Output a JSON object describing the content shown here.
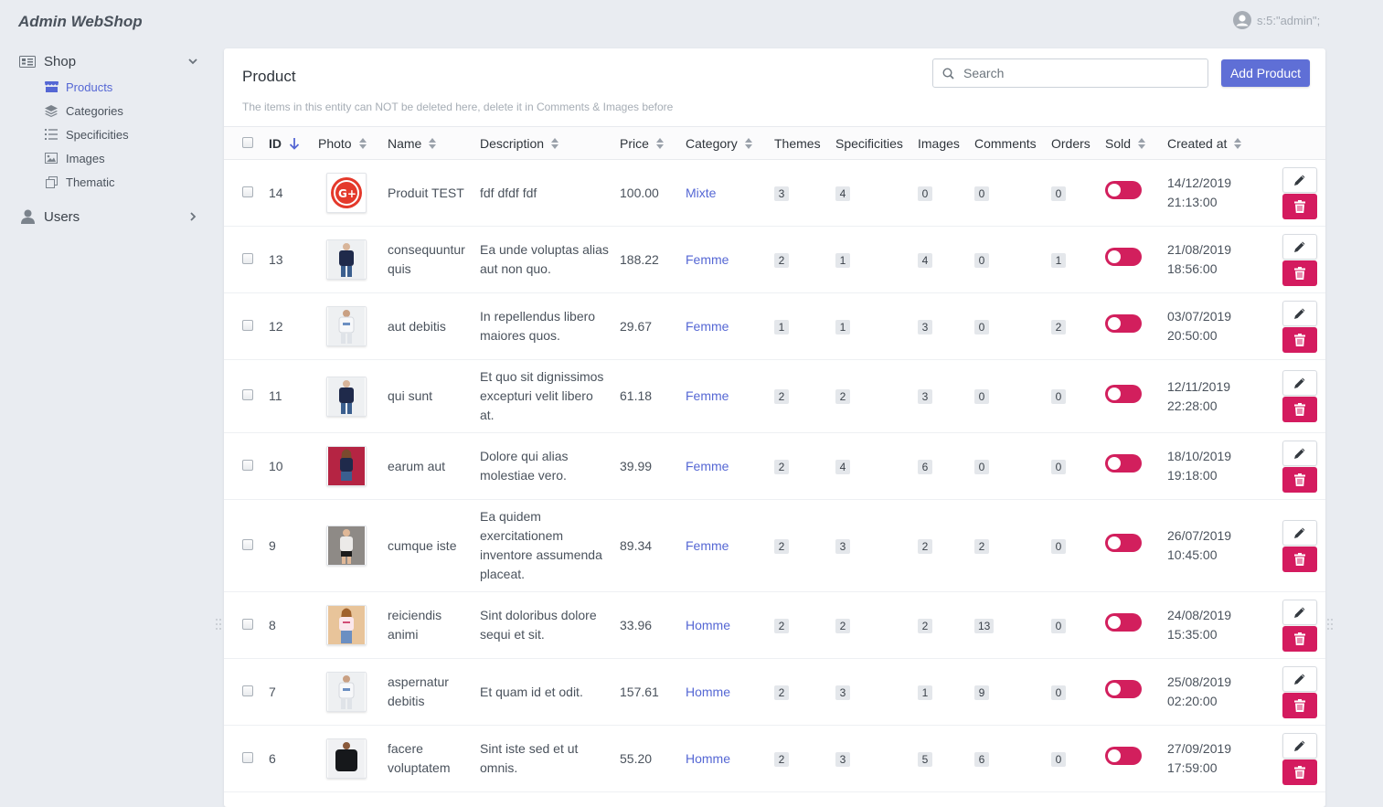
{
  "app": {
    "title": "Admin WebShop",
    "user": "s:5:\"admin\";"
  },
  "sidebar": {
    "shop": {
      "label": "Shop",
      "icon": "shop-icon"
    },
    "shop_items": [
      {
        "label": "Products",
        "icon": "store-icon",
        "active": true
      },
      {
        "label": "Categories",
        "icon": "layers-icon",
        "active": false
      },
      {
        "label": "Specificities",
        "icon": "list-icon",
        "active": false
      },
      {
        "label": "Images",
        "icon": "image-icon",
        "active": false
      },
      {
        "label": "Thematic",
        "icon": "clone-icon",
        "active": false
      }
    ],
    "users": {
      "label": "Users",
      "icon": "user-icon"
    }
  },
  "panel": {
    "title": "Product",
    "search_placeholder": "Search",
    "add_label": "Add Product",
    "help": "The items in this entity can NOT be deleted here, delete it in Comments & Images before"
  },
  "table": {
    "headers": {
      "id": "ID",
      "photo": "Photo",
      "name": "Name",
      "description": "Description",
      "price": "Price",
      "category": "Category",
      "themes": "Themes",
      "specificities": "Specificities",
      "images": "Images",
      "comments": "Comments",
      "orders": "Orders",
      "sold": "Sold",
      "created": "Created at"
    },
    "rows": [
      {
        "id": "14",
        "photo": "gplus",
        "name": "Produit TEST",
        "description": "fdf dfdf fdf",
        "price": "100.00",
        "category": "Mixte",
        "themes": "3",
        "specificities": "4",
        "images": "0",
        "comments": "0",
        "orders": "0",
        "date": "14/12/2019",
        "time": "21:13:00"
      },
      {
        "id": "13",
        "photo": "navy",
        "name": "consequuntur quis",
        "description": "Ea unde voluptas alias aut non quo.",
        "price": "188.22",
        "category": "Femme",
        "themes": "2",
        "specificities": "1",
        "images": "4",
        "comments": "0",
        "orders": "1",
        "date": "21/08/2019",
        "time": "18:56:00"
      },
      {
        "id": "12",
        "photo": "white",
        "name": "aut debitis",
        "description": "In repellendus libero maiores quos.",
        "price": "29.67",
        "category": "Femme",
        "themes": "1",
        "specificities": "1",
        "images": "3",
        "comments": "0",
        "orders": "2",
        "date": "03/07/2019",
        "time": "20:50:00"
      },
      {
        "id": "11",
        "photo": "navy",
        "name": "qui sunt",
        "description": "Et quo sit dignissimos excepturi velit libero at.",
        "price": "61.18",
        "category": "Femme",
        "themes": "2",
        "specificities": "2",
        "images": "3",
        "comments": "0",
        "orders": "0",
        "date": "12/11/2019",
        "time": "22:28:00"
      },
      {
        "id": "10",
        "photo": "red",
        "name": "earum aut",
        "description": "Dolore qui alias molestiae vero.",
        "price": "39.99",
        "category": "Femme",
        "themes": "2",
        "specificities": "4",
        "images": "6",
        "comments": "0",
        "orders": "0",
        "date": "18/10/2019",
        "time": "19:18:00"
      },
      {
        "id": "9",
        "photo": "grey",
        "name": "cumque iste",
        "description": "Ea quidem exercitationem inventore assumenda placeat.",
        "price": "89.34",
        "category": "Femme",
        "themes": "2",
        "specificities": "3",
        "images": "2",
        "comments": "2",
        "orders": "0",
        "date": "26/07/2019",
        "time": "10:45:00"
      },
      {
        "id": "8",
        "photo": "pink",
        "name": "reiciendis animi",
        "description": "Sint doloribus dolore sequi et sit.",
        "price": "33.96",
        "category": "Homme",
        "themes": "2",
        "specificities": "2",
        "images": "2",
        "comments": "13",
        "orders": "0",
        "date": "24/08/2019",
        "time": "15:35:00"
      },
      {
        "id": "7",
        "photo": "white",
        "name": "aspernatur debitis",
        "description": "Et quam id et odit.",
        "price": "157.61",
        "category": "Homme",
        "themes": "2",
        "specificities": "3",
        "images": "1",
        "comments": "9",
        "orders": "0",
        "date": "25/08/2019",
        "time": "02:20:00"
      },
      {
        "id": "6",
        "photo": "black",
        "name": "facere voluptatem",
        "description": "Sint iste sed et ut omnis.",
        "price": "55.20",
        "category": "Homme",
        "themes": "2",
        "specificities": "3",
        "images": "5",
        "comments": "6",
        "orders": "0",
        "date": "27/09/2019",
        "time": "17:59:00"
      }
    ]
  },
  "colors": {
    "accent": "#5f6fd6",
    "danger": "#d41b5f",
    "link": "#5567d4",
    "background": "#e9ecf1"
  }
}
